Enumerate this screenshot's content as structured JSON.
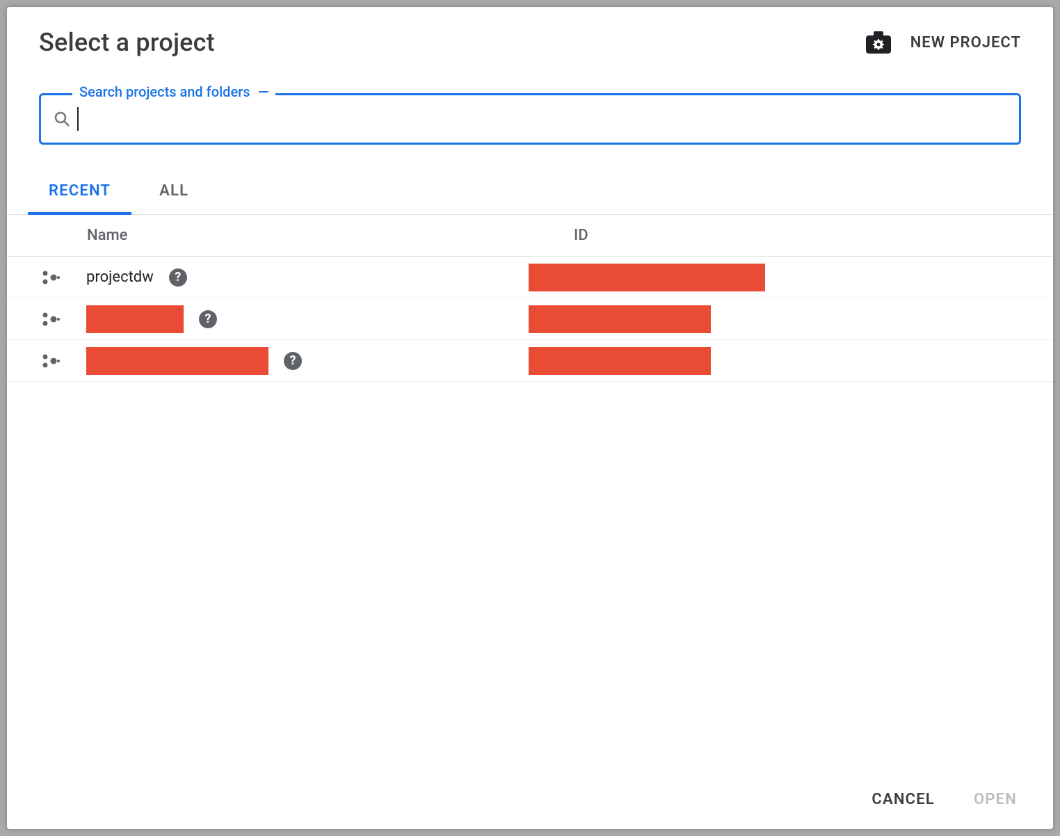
{
  "dialog": {
    "title": "Select a project",
    "new_project_label": "NEW PROJECT"
  },
  "search": {
    "label": "Search projects and folders",
    "value": "",
    "placeholder": ""
  },
  "tabs": [
    {
      "label": "RECENT",
      "active": true
    },
    {
      "label": "ALL",
      "active": false
    }
  ],
  "columns": {
    "name": "Name",
    "id": "ID"
  },
  "rows": [
    {
      "name": "projectdw",
      "name_redacted": false,
      "name_redact_width": 0,
      "id_redact_width": 340
    },
    {
      "name": "",
      "name_redacted": true,
      "name_redact_width": 140,
      "id_redact_width": 262
    },
    {
      "name": "",
      "name_redacted": true,
      "name_redact_width": 262,
      "id_redact_width": 262
    }
  ],
  "footer": {
    "cancel": "CANCEL",
    "open": "OPEN"
  }
}
